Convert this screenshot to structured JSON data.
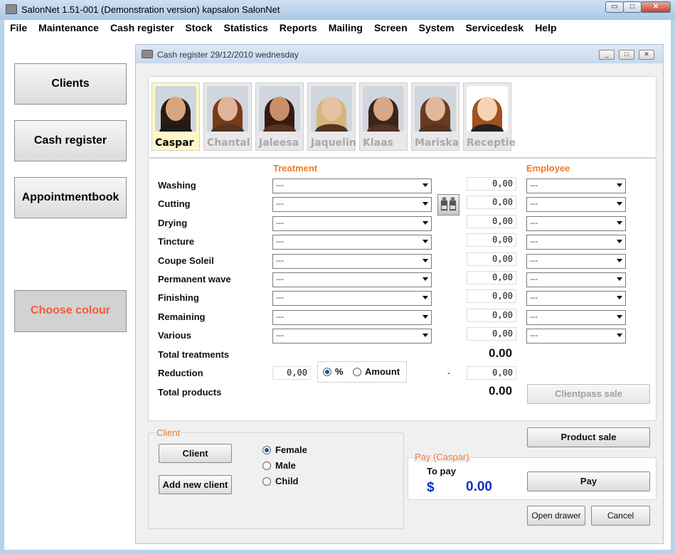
{
  "window": {
    "title": "SalonNet 1.51-001 (Demonstration version) kapsalon SalonNet",
    "min": "▭",
    "max": "□",
    "close": "✕"
  },
  "menu": [
    "File",
    "Maintenance",
    "Cash register",
    "Stock",
    "Statistics",
    "Reports",
    "Mailing",
    "Screen",
    "System",
    "Servicedesk",
    "Help"
  ],
  "sidebar": {
    "clients": "Clients",
    "cash_register": "Cash register",
    "appointmentbook": "Appointmentbook",
    "choose_colour": "Choose colour"
  },
  "child": {
    "title": "Cash register 29/12/2010 wednesday"
  },
  "employees": [
    {
      "name": "Caspar",
      "selected": true,
      "hair": "#2a1a10",
      "skin": "#d9a580"
    },
    {
      "name": "Chantal",
      "selected": false,
      "hair": "#7a3a1a",
      "skin": "#e0b59a"
    },
    {
      "name": "Jaleesa",
      "selected": false,
      "hair": "#3a1a10",
      "skin": "#c98f6a"
    },
    {
      "name": "Jaquelin",
      "selected": false,
      "hair": "#d6b67a",
      "skin": "#e6c2a2"
    },
    {
      "name": "Klaas",
      "selected": false,
      "hair": "#3a2618",
      "skin": "#d8a78a"
    },
    {
      "name": "Mariska",
      "selected": false,
      "hair": "#6b3a22",
      "skin": "#e3b89a"
    },
    {
      "name": "Receptie",
      "selected": false,
      "hair": "#a0521f",
      "skin": "#f6d3b3"
    }
  ],
  "headers": {
    "treatment": "Treatment",
    "employee": "Employee"
  },
  "treatments": [
    {
      "label": "Washing",
      "treatment": "---",
      "amount": "0,00",
      "employee": "---"
    },
    {
      "label": "Cutting",
      "treatment": "---",
      "amount": "0,00",
      "employee": "---"
    },
    {
      "label": "Drying",
      "treatment": "---",
      "amount": "0,00",
      "employee": "---"
    },
    {
      "label": "Tincture",
      "treatment": "---",
      "amount": "0,00",
      "employee": "---"
    },
    {
      "label": "Coupe Soleil",
      "treatment": "---",
      "amount": "0,00",
      "employee": "---"
    },
    {
      "label": "Permanent wave",
      "treatment": "---",
      "amount": "0,00",
      "employee": "---"
    },
    {
      "label": "Finishing",
      "treatment": "---",
      "amount": "0,00",
      "employee": "---"
    },
    {
      "label": "Remaining",
      "treatment": "---",
      "amount": "0,00",
      "employee": "---"
    },
    {
      "label": "Various",
      "treatment": "---",
      "amount": "0,00",
      "employee": "---"
    }
  ],
  "totals": {
    "total_treatments_label": "Total treatments",
    "total_treatments": "0.00",
    "reduction_label": "Reduction",
    "reduction_value": "0,00",
    "percent_label": "%",
    "amount_label": "Amount",
    "minus": "-",
    "reduction_amount": "0,00",
    "total_products_label": "Total products",
    "total_products": "0.00"
  },
  "buttons": {
    "clientpass_sale": "Clientpass sale",
    "product_sale": "Product sale",
    "pay": "Pay",
    "open_drawer": "Open drawer",
    "cancel": "Cancel",
    "client": "Client",
    "add_new_client": "Add new client"
  },
  "client": {
    "legend": "Client",
    "female": "Female",
    "male": "Male",
    "child": "Child",
    "selected": "Female"
  },
  "pay": {
    "legend": "Pay (Caspar)",
    "to_pay_label": "To pay",
    "currency": "$",
    "amount": "0.00"
  },
  "colors": {
    "accent_orange": "#f07a2a",
    "pay_blue": "#1030c0",
    "choose_colour_text": "#f05a3a"
  }
}
